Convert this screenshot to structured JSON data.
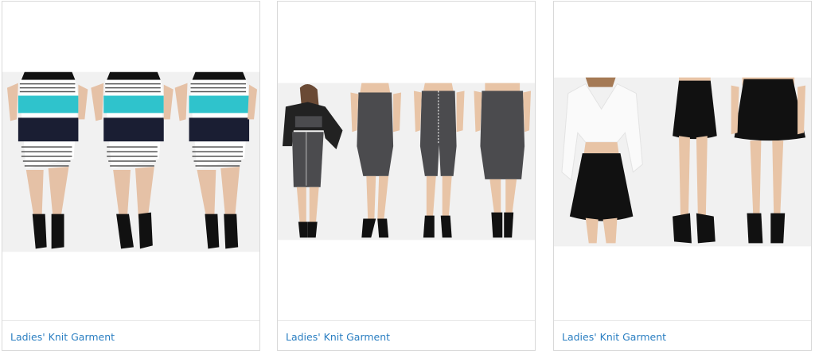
{
  "products": [
    {
      "title": "Ladies' Knit Garment",
      "image": "three views of a striped knit pencil skirt (turquoise, navy, white stripes) with black lace-up heels",
      "colors": {
        "primary": "#2fc3cc",
        "secondary": "#1a1e33"
      }
    },
    {
      "title": "Ladies' Knit Garment",
      "image": "four views of a charcoal grey knit midi pencil skirt, including a front-zip slit version",
      "colors": {
        "primary": "#4b4b4e",
        "secondary": "#111111"
      }
    },
    {
      "title": "Ladies' Knit Garment",
      "image": "three views of a black knit skater skirt worn with a white tie-front top",
      "colors": {
        "primary": "#111111",
        "secondary": "#f4f4f4"
      }
    }
  ],
  "theme": {
    "link_color": "#2b7fc2",
    "border_color": "#d9d9d9"
  }
}
